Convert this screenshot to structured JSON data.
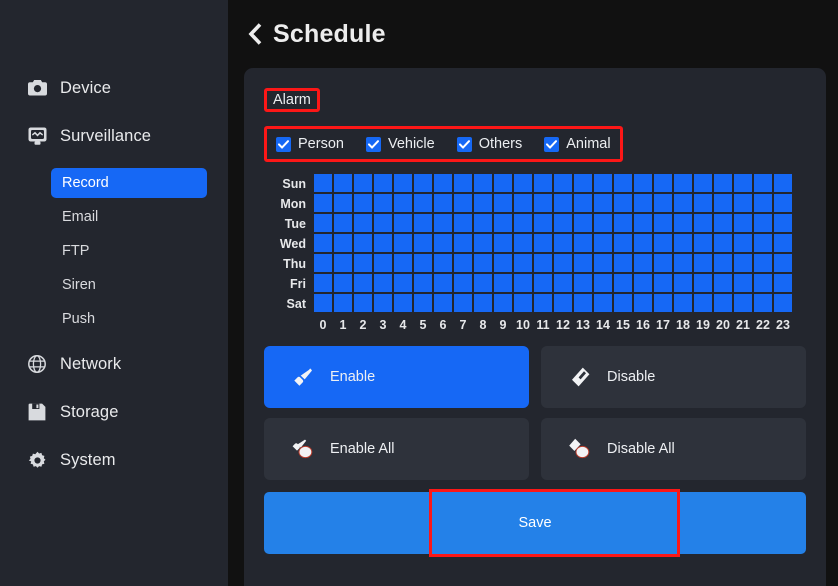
{
  "sidebar": {
    "groups": [
      {
        "icon": "camera-icon",
        "label": "Device",
        "children": []
      },
      {
        "icon": "webcam-icon",
        "label": "Surveillance",
        "children": [
          {
            "label": "Record",
            "active": true
          },
          {
            "label": "Email",
            "active": false
          },
          {
            "label": "FTP",
            "active": false
          },
          {
            "label": "Siren",
            "active": false
          },
          {
            "label": "Push",
            "active": false
          }
        ]
      },
      {
        "icon": "globe-icon",
        "label": "Network",
        "children": []
      },
      {
        "icon": "floppy-disk-icon",
        "label": "Storage",
        "children": []
      },
      {
        "icon": "gear-icon",
        "label": "System",
        "children": []
      }
    ]
  },
  "header": {
    "back_icon": "chevron-left-icon",
    "title": "Schedule"
  },
  "content": {
    "tabs": [
      {
        "label": "Alarm",
        "selected": true,
        "highlighted": true
      }
    ],
    "detection_types": [
      {
        "label": "Person",
        "checked": true
      },
      {
        "label": "Vehicle",
        "checked": true
      },
      {
        "label": "Others",
        "checked": true
      },
      {
        "label": "Animal",
        "checked": true
      }
    ],
    "detection_types_highlighted": true,
    "schedule": {
      "days": [
        "Sun",
        "Mon",
        "Tue",
        "Wed",
        "Thu",
        "Fri",
        "Sat"
      ],
      "hours": [
        "0",
        "1",
        "2",
        "3",
        "4",
        "5",
        "6",
        "7",
        "8",
        "9",
        "10",
        "11",
        "12",
        "13",
        "14",
        "15",
        "16",
        "17",
        "18",
        "19",
        "20",
        "21",
        "22",
        "23"
      ],
      "cells": [
        [
          1,
          1,
          1,
          1,
          1,
          1,
          1,
          1,
          1,
          1,
          1,
          1,
          1,
          1,
          1,
          1,
          1,
          1,
          1,
          1,
          1,
          1,
          1,
          1
        ],
        [
          1,
          1,
          1,
          1,
          1,
          1,
          1,
          1,
          1,
          1,
          1,
          1,
          1,
          1,
          1,
          1,
          1,
          1,
          1,
          1,
          1,
          1,
          1,
          1
        ],
        [
          1,
          1,
          1,
          1,
          1,
          1,
          1,
          1,
          1,
          1,
          1,
          1,
          1,
          1,
          1,
          1,
          1,
          1,
          1,
          1,
          1,
          1,
          1,
          1
        ],
        [
          1,
          1,
          1,
          1,
          1,
          1,
          1,
          1,
          1,
          1,
          1,
          1,
          1,
          1,
          1,
          1,
          1,
          1,
          1,
          1,
          1,
          1,
          1,
          1
        ],
        [
          1,
          1,
          1,
          1,
          1,
          1,
          1,
          1,
          1,
          1,
          1,
          1,
          1,
          1,
          1,
          1,
          1,
          1,
          1,
          1,
          1,
          1,
          1,
          1
        ],
        [
          1,
          1,
          1,
          1,
          1,
          1,
          1,
          1,
          1,
          1,
          1,
          1,
          1,
          1,
          1,
          1,
          1,
          1,
          1,
          1,
          1,
          1,
          1,
          1
        ],
        [
          1,
          1,
          1,
          1,
          1,
          1,
          1,
          1,
          1,
          1,
          1,
          1,
          1,
          1,
          1,
          1,
          1,
          1,
          1,
          1,
          1,
          1,
          1,
          1
        ]
      ]
    },
    "tools": [
      {
        "label": "Enable",
        "icon": "brush-icon",
        "selected": true
      },
      {
        "label": "Disable",
        "icon": "eraser-icon",
        "selected": false
      },
      {
        "label": "Enable All",
        "icon": "brush-all-icon",
        "selected": false
      },
      {
        "label": "Disable All",
        "icon": "eraser-all-icon",
        "selected": false
      }
    ],
    "save": {
      "label": "Save",
      "highlighted": true
    }
  },
  "colors": {
    "accent": "#1668f5",
    "save": "#2481e8",
    "highlight": "#fc1717",
    "sidebar_bg": "#23262e",
    "page_bg": "#111111",
    "button_bg": "#2e323b",
    "cell_off": "#3a3e48"
  }
}
